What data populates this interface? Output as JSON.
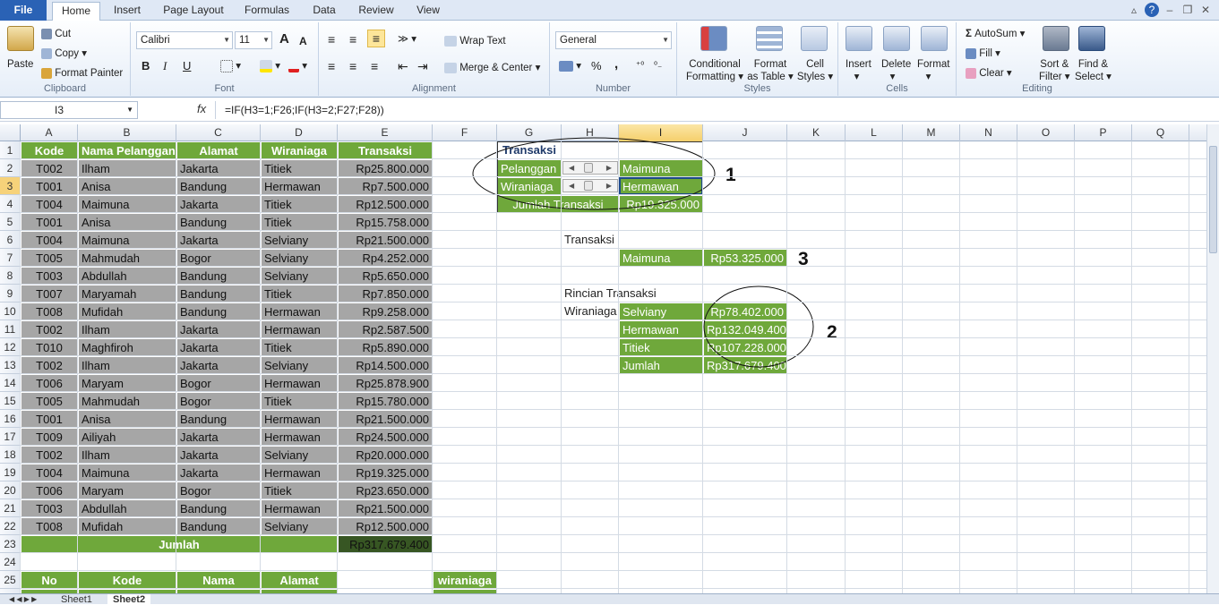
{
  "tabs": [
    "File",
    "Home",
    "Insert",
    "Page Layout",
    "Formulas",
    "Data",
    "Review",
    "View"
  ],
  "active_tab": "Home",
  "ribbon": {
    "clipboard": {
      "paste": "Paste",
      "cut": "Cut",
      "copy": "Copy",
      "format_painter": "Format Painter",
      "label": "Clipboard"
    },
    "font": {
      "name": "Calibri",
      "size": "11",
      "label": "Font",
      "bold": "B",
      "italic": "I",
      "underline": "U",
      "grow": "A",
      "shrink": "A"
    },
    "alignment": {
      "wrap": "Wrap Text",
      "merge": "Merge & Center",
      "label": "Alignment"
    },
    "number": {
      "format": "General",
      "percent": "%",
      "comma": ",",
      "label": "Number"
    },
    "styles": {
      "conditional": "Conditional",
      "conditional2": "Formatting",
      "format_table": "Format",
      "format_table2": "as Table",
      "cell_styles": "Cell",
      "cell_styles2": "Styles",
      "label": "Styles"
    },
    "cells": {
      "insert": "Insert",
      "delete": "Delete",
      "format": "Format",
      "label": "Cells"
    },
    "editing": {
      "autosum": "AutoSum",
      "fill": "Fill",
      "clear": "Clear",
      "sort": "Sort &",
      "sort2": "Filter",
      "find": "Find &",
      "find2": "Select",
      "label": "Editing"
    }
  },
  "formula_bar": {
    "name_box": "I3",
    "fx": "fx",
    "formula": "=IF(H3=1;F26;IF(H3=2;F27;F28))"
  },
  "columns": [
    "A",
    "B",
    "C",
    "D",
    "E",
    "F",
    "G",
    "H",
    "I",
    "J",
    "K",
    "L",
    "M",
    "N",
    "O",
    "P",
    "Q"
  ],
  "rows": [
    "1",
    "2",
    "3",
    "4",
    "5",
    "6",
    "7",
    "8",
    "9",
    "10",
    "11",
    "12",
    "13",
    "14",
    "15",
    "16",
    "17",
    "18",
    "19",
    "20",
    "21",
    "22",
    "23",
    "24",
    "25",
    "26"
  ],
  "main_table": {
    "headers": [
      "Kode",
      "Nama Pelanggan",
      "Alamat",
      "Wiraniaga",
      "Transaksi"
    ],
    "rows": [
      [
        "T002",
        "Ilham",
        "Jakarta",
        "Titiek",
        "Rp25.800.000"
      ],
      [
        "T001",
        "Anisa",
        "Bandung",
        "Hermawan",
        "Rp7.500.000"
      ],
      [
        "T004",
        "Maimuna",
        "Jakarta",
        "Titiek",
        "Rp12.500.000"
      ],
      [
        "T001",
        "Anisa",
        "Bandung",
        "Titiek",
        "Rp15.758.000"
      ],
      [
        "T004",
        "Maimuna",
        "Jakarta",
        "Selviany",
        "Rp21.500.000"
      ],
      [
        "T005",
        "Mahmudah",
        "Bogor",
        "Selviany",
        "Rp4.252.000"
      ],
      [
        "T003",
        "Abdullah",
        "Bandung",
        "Selviany",
        "Rp5.650.000"
      ],
      [
        "T007",
        "Maryamah",
        "Bandung",
        "Titiek",
        "Rp7.850.000"
      ],
      [
        "T008",
        "Mufidah",
        "Bandung",
        "Hermawan",
        "Rp9.258.000"
      ],
      [
        "T002",
        "Ilham",
        "Jakarta",
        "Hermawan",
        "Rp2.587.500"
      ],
      [
        "T010",
        "Maghfiroh",
        "Jakarta",
        "Titiek",
        "Rp5.890.000"
      ],
      [
        "T002",
        "Ilham",
        "Jakarta",
        "Selviany",
        "Rp14.500.000"
      ],
      [
        "T006",
        "Maryam",
        "Bogor",
        "Hermawan",
        "Rp25.878.900"
      ],
      [
        "T005",
        "Mahmudah",
        "Bogor",
        "Titiek",
        "Rp15.780.000"
      ],
      [
        "T001",
        "Anisa",
        "Bandung",
        "Hermawan",
        "Rp21.500.000"
      ],
      [
        "T009",
        "Ailiyah",
        "Jakarta",
        "Hermawan",
        "Rp24.500.000"
      ],
      [
        "T002",
        "Ilham",
        "Jakarta",
        "Selviany",
        "Rp20.000.000"
      ],
      [
        "T004",
        "Maimuna",
        "Jakarta",
        "Hermawan",
        "Rp19.325.000"
      ],
      [
        "T006",
        "Maryam",
        "Bogor",
        "Titiek",
        "Rp23.650.000"
      ],
      [
        "T003",
        "Abdullah",
        "Bandung",
        "Hermawan",
        "Rp21.500.000"
      ],
      [
        "T008",
        "Mufidah",
        "Bandung",
        "Selviany",
        "Rp12.500.000"
      ]
    ],
    "total_label": "Jumlah",
    "total_value": "Rp317.679.400"
  },
  "second_table": {
    "headers": [
      "No",
      "Kode",
      "Nama",
      "Alamat"
    ],
    "f_header": "wiraniaga"
  },
  "panel": {
    "title": "Transaksi",
    "pelanggan_label": "Pelanggan",
    "pelanggan_value": "Maimuna",
    "wiraniaga_label": "Wiraniaga",
    "wiraniaga_value": "Hermawan",
    "jumlah_label": "Jumlah Transaksi",
    "jumlah_value": "Rp19.325.000"
  },
  "transaksi2": {
    "title": "Transaksi",
    "name": "Maimuna",
    "value": "Rp53.325.000"
  },
  "rincian": {
    "title": "Rincian Transaksi",
    "label": "Wiraniaga",
    "rows": [
      [
        "Selviany",
        "Rp78.402.000"
      ],
      [
        "Hermawan",
        "Rp132.049.400"
      ],
      [
        "Titiek",
        "Rp107.228.000"
      ],
      [
        "Jumlah",
        "Rp317.679.400"
      ]
    ]
  },
  "annotations": [
    "1",
    "2",
    "3"
  ],
  "sheets": [
    "Sheet1",
    "Sheet2"
  ],
  "active_sheet": "Sheet2"
}
